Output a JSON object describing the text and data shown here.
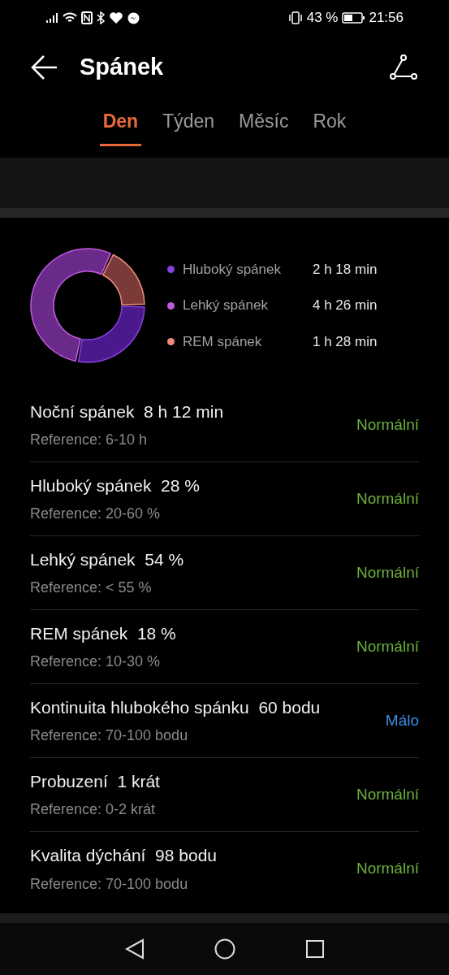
{
  "status_bar": {
    "battery": "43 %",
    "time": "21:56"
  },
  "header": {
    "title": "Spánek"
  },
  "tabs": [
    {
      "label": "Den",
      "selected": true
    },
    {
      "label": "Týden",
      "selected": false
    },
    {
      "label": "Měsíc",
      "selected": false
    },
    {
      "label": "Rok",
      "selected": false
    }
  ],
  "chart_data": {
    "type": "donut",
    "categories": [
      "Hluboký spánek",
      "Lehký spánek",
      "REM spánek"
    ],
    "values": [
      28,
      54,
      18
    ]
  },
  "legend": [
    {
      "value": "2 h 18 min",
      "color": "#8a3fe0"
    },
    {
      "value": "4 h 26 min",
      "color": "#c05ae0"
    },
    {
      "value": "1 h 28 min",
      "color": "#f08a7a"
    }
  ],
  "metrics": [
    {
      "title": "Noční spánek  8 h 12 min",
      "reference": "Reference: 6-10 h",
      "status": "Normální",
      "color": "#6db23c"
    },
    {
      "title": "Hluboký spánek  28 %",
      "reference": "Reference: 20-60 %",
      "status": "Normální",
      "color": "#6db23c"
    },
    {
      "title": "Lehký spánek  54 %",
      "reference": "Reference: < 55 %",
      "status": "Normální",
      "color": "#6db23c"
    },
    {
      "title": "REM spánek  18 %",
      "reference": "Reference: 10-30 %",
      "status": "Normální",
      "color": "#6db23c"
    },
    {
      "title": "Kontinuita hlubokého spánku  60 bodu",
      "reference": "Reference: 70-100 bodu",
      "status": "Málo",
      "color": "#3a8ee6"
    },
    {
      "title": "Probuzení  1 krát",
      "reference": "Reference: 0-2 krát",
      "status": "Normální",
      "color": "#6db23c"
    },
    {
      "title": "Kvalita dýchání  98 bodu",
      "reference": "Reference: 70-100 bodu",
      "status": "Normální",
      "color": "#6db23c"
    }
  ]
}
